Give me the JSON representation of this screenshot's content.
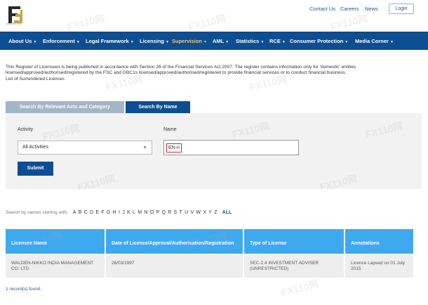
{
  "logo": {
    "name": "fsc-logo-icon",
    "tagline": "MAURITIUS"
  },
  "header": {
    "links": [
      "Contact Us",
      "Careers",
      "News"
    ],
    "login_label": "Login"
  },
  "nav": [
    {
      "label": "About Us",
      "active": false
    },
    {
      "label": "Enforcement",
      "active": false
    },
    {
      "label": "Legal Framework",
      "active": false
    },
    {
      "label": "Licensing",
      "active": false
    },
    {
      "label": "Supervision",
      "active": true
    },
    {
      "label": "AML",
      "active": false
    },
    {
      "label": "Statistics",
      "active": false
    },
    {
      "label": "RCE",
      "active": false
    },
    {
      "label": "Consumer Protection",
      "active": false
    },
    {
      "label": "Media Corner",
      "active": false
    }
  ],
  "intro": {
    "line1": "This Register of Licensees is being published in accordance with Section 26 of the Financial Services Act 2007. The register contains information only for 'domestic' entities",
    "line2": "licensed/approved/authorised/registered by the FSC and GBC1s licensed/approved/authorised/registered to provide financial services or to conduct financial business.",
    "line3": "List of Surrendered Licences"
  },
  "search": {
    "tabs": [
      "Search By Relevant Acts and Category",
      "Search By Name"
    ],
    "activity_label": "Activity",
    "activity_value": "All Activities",
    "name_label": "Name",
    "name_value": "EN-n",
    "submit_label": "Submit"
  },
  "alphabet": {
    "prefix": "Search by names starting with:",
    "letters": [
      "A",
      "B",
      "C",
      "D",
      "E",
      "F",
      "G",
      "H",
      "I",
      "J",
      "K",
      "L",
      "M",
      "N",
      "O",
      "P",
      "Q",
      "R",
      "S",
      "T",
      "U",
      "V",
      "W",
      "X",
      "Y",
      "Z"
    ],
    "all_label": "ALL"
  },
  "table": {
    "headers": [
      "Licensee Name",
      "Date of Licence/Approval/Authorisation/Registration",
      "Type of License",
      "Annotations"
    ],
    "rows": [
      [
        "WALDEN-NIKKO INDIA MANAGEMENT CO. LTD.",
        "26/03/1997",
        "SEC-2.4 INVESTMENT ADVISER (UNRESTRICTED)",
        "Licence Lapsed on 01 July 2015"
      ]
    ],
    "count_text": "1 record(s) found."
  },
  "watermark": "FX110网",
  "colors": {
    "nav": "#0c4e91",
    "accent": "#f7c66b",
    "table_header": "#3fa9f0"
  }
}
